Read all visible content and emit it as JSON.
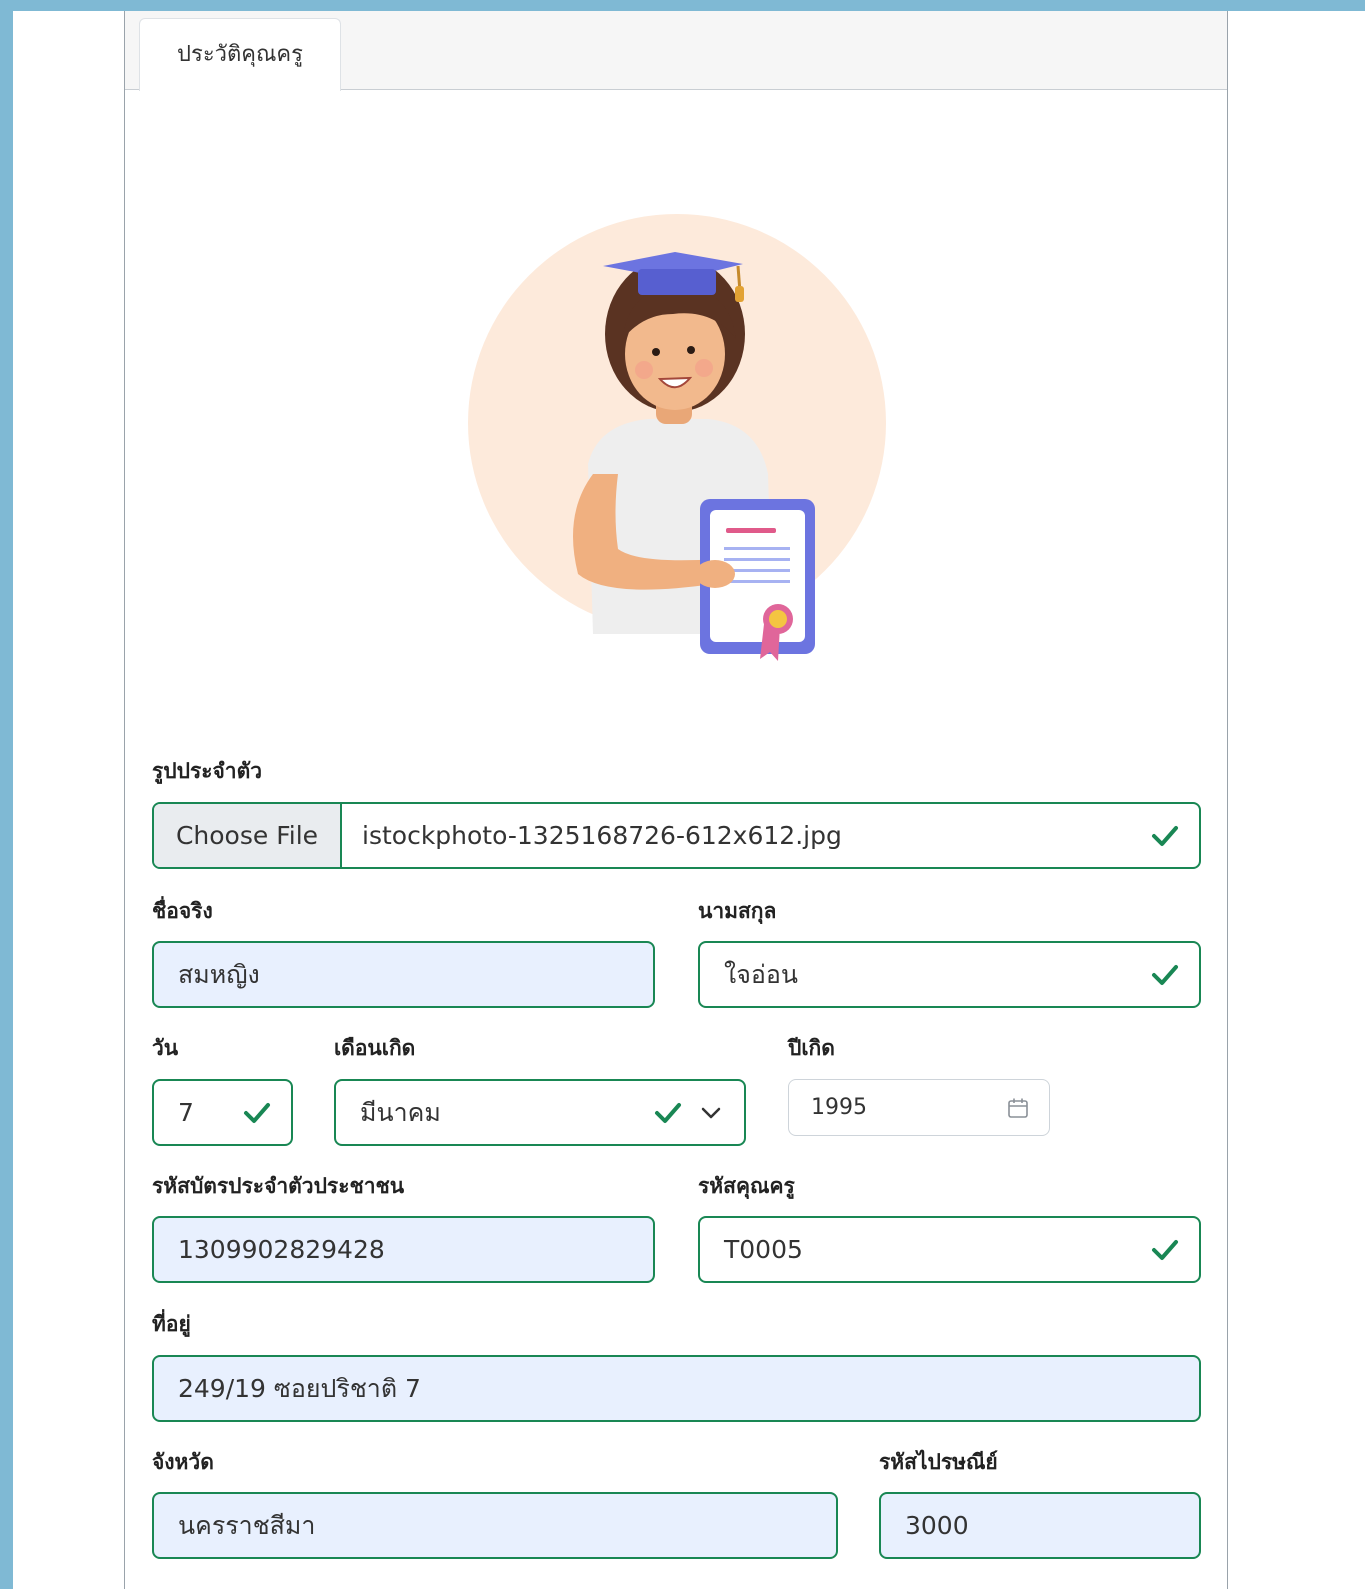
{
  "tab": {
    "label": "ประวัติคุณครู"
  },
  "avatar": {
    "icon": "teacher-graduate-avatar"
  },
  "form": {
    "photo_label": "รูปประจำตัว",
    "file_button": "Choose File",
    "file_name": "istockphoto-1325168726-612x612.jpg",
    "firstname_label": "ชื่อจริง",
    "firstname_value": "สมหญิง",
    "lastname_label": "นามสกุล",
    "lastname_value": "ใจอ่อน",
    "day_label": "วัน",
    "day_value": "7",
    "month_label": "เดือนเกิด",
    "month_value": "มีนาคม",
    "year_label": "ปีเกิด",
    "year_value": "1995",
    "idcard_label": "รหัสบัตรประจำตัวประชาชน",
    "idcard_value": "1309902829428",
    "teacher_code_label": "รหัสคุณครู",
    "teacher_code_value": "T0005",
    "address_label": "ที่อยู่",
    "address_value": "249/19 ซอยปริชาติ 7",
    "province_label": "จังหวัด",
    "province_value": "นครราชสีมา",
    "postcode_label": "รหัสไปรษณีย์",
    "postcode_value": "3000"
  },
  "colors": {
    "valid_border": "#198754",
    "autofill_bg": "#e8f0fe",
    "outer_bg": "#7fb9d4"
  }
}
